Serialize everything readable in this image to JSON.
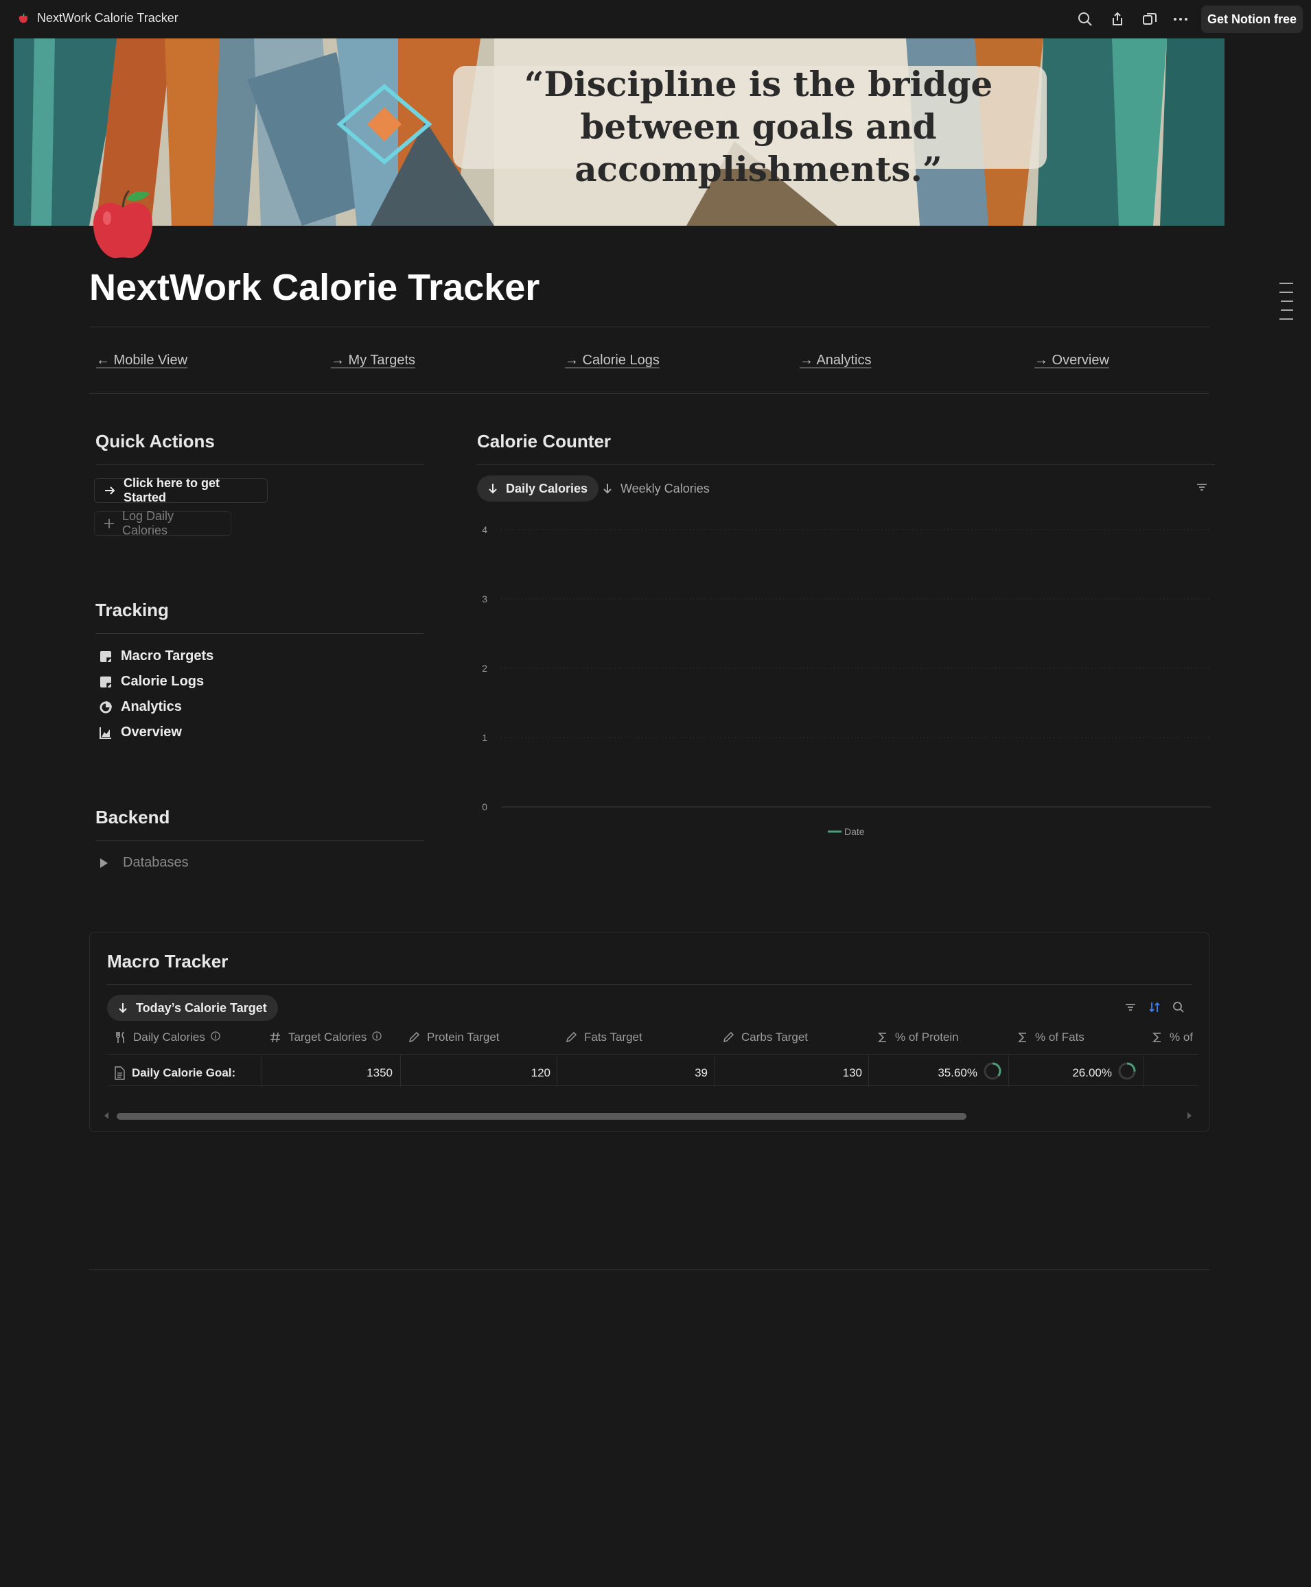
{
  "topbar": {
    "title": "NextWork Calorie Tracker",
    "cta_label": "Get Notion free",
    "icons": [
      "apple-icon",
      "search-icon",
      "share-icon",
      "duplicate-icon",
      "more-icon"
    ]
  },
  "cover": {
    "quote": "“Discipline is the bridge between goals and accomplishments.”"
  },
  "page": {
    "icon": "red-apple-icon",
    "title": "NextWork Calorie Tracker"
  },
  "nav_links": [
    {
      "label": "← Mobile View"
    },
    {
      "label": "→ My Targets"
    },
    {
      "label": "→ Calorie Logs"
    },
    {
      "label": "→ Analytics"
    },
    {
      "label": "→ Overview"
    }
  ],
  "quick_actions": {
    "title": "Quick Actions",
    "buttons": [
      {
        "label": "Click here to get Started",
        "icon": "arrow-right-icon"
      },
      {
        "label": "Log Daily Calories",
        "icon": "plus-icon"
      }
    ]
  },
  "tracking": {
    "title": "Tracking",
    "items": [
      {
        "label": "Macro Targets",
        "icon": "database-icon"
      },
      {
        "label": "Calorie Logs",
        "icon": "database-icon"
      },
      {
        "label": "Analytics",
        "icon": "pie-chart-icon"
      },
      {
        "label": "Overview",
        "icon": "line-chart-icon"
      }
    ]
  },
  "backend": {
    "title": "Backend",
    "toggle_label": "Databases"
  },
  "calorie_counter": {
    "title": "Calorie Counter",
    "tabs": [
      {
        "label": "Daily Calories",
        "active": true
      },
      {
        "label": "Weekly Calories",
        "active": false
      }
    ]
  },
  "chart_data": {
    "type": "line",
    "title": "",
    "xlabel": "",
    "ylabel": "",
    "ylim": [
      0,
      4
    ],
    "yticks": [
      "0",
      "1",
      "2",
      "3",
      "4"
    ],
    "x": [],
    "series": [
      {
        "name": "Date",
        "values": [],
        "color": "#4c9e7a"
      }
    ],
    "grid": true,
    "legend": "bottom-center"
  },
  "macro_tracker": {
    "title": "Macro Tracker",
    "view_label": "Today’s Calorie Target",
    "columns": [
      {
        "label": "Daily Calories",
        "icon": "fork-knife-icon",
        "info": true
      },
      {
        "label": "Target Calories",
        "icon": "hash-icon",
        "info": true
      },
      {
        "label": "Protein Target",
        "icon": "pencil-icon",
        "info": false
      },
      {
        "label": "Fats Target",
        "icon": "pencil-icon",
        "info": false
      },
      {
        "label": "Carbs Target",
        "icon": "pencil-icon",
        "info": false
      },
      {
        "label": "% of Protein",
        "icon": "sigma-icon",
        "info": false
      },
      {
        "label": "% of Fats",
        "icon": "sigma-icon",
        "info": false
      },
      {
        "label": "% of",
        "icon": "sigma-icon",
        "info": false
      }
    ],
    "rows": [
      {
        "name": "Daily Calorie Goal:",
        "target_calories": "1350",
        "protein_target": "120",
        "fats_target": "39",
        "carbs_target": "130",
        "pct_protein": "35.60%",
        "pct_protein_value": 0.356,
        "pct_fats": "26.00%",
        "pct_fats_value": 0.26
      }
    ],
    "colors": {
      "ring": "#4c9e7a",
      "sort_icon": "#3b82f6"
    }
  }
}
